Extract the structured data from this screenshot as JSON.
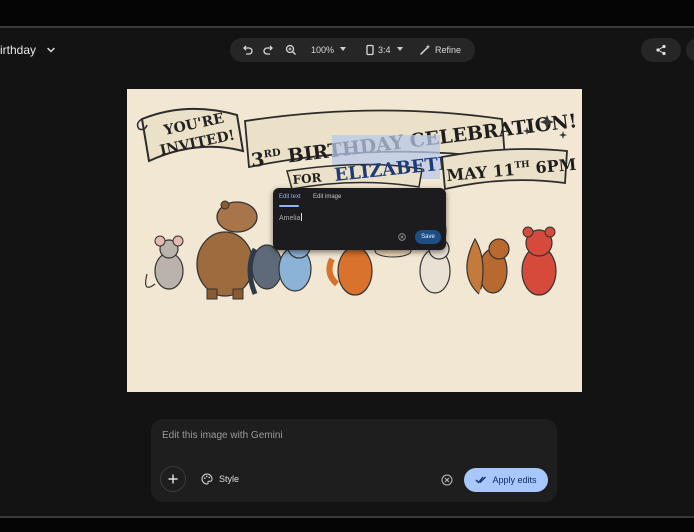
{
  "header": {
    "title": "irthday",
    "undo_icon": "undo-icon",
    "redo_icon": "redo-icon",
    "zoom_icon": "zoom-in-icon",
    "zoom_value": "100%",
    "aspect_icon": "aspect-ratio-icon",
    "aspect_value": "3:4",
    "refine_label": "Refine",
    "share_icon": "share-icon"
  },
  "image": {
    "banner_left_line1": "YOU'RE",
    "banner_left_line2": "INVITED!",
    "headline_prefix": "3",
    "headline_sup": "RD",
    "headline_main": " BIRTHDAY CELEBRATION!",
    "for_label": "FOR",
    "name": "ELIZABETH",
    "date_prefix": "MAY 11",
    "date_sup": "TH",
    "time": " 6PM"
  },
  "edit_popup": {
    "tab_edit_text": "Edit text",
    "tab_edit_image": "Edit image",
    "input_value": "Amelia",
    "save_label": "Save"
  },
  "prompt": {
    "placeholder": "Edit this image with Gemini",
    "style_label": "Style",
    "apply_label": "Apply edits"
  },
  "colors": {
    "accent": "#a8c7fa",
    "save_button": "#1d4f86",
    "background": "#131313",
    "parchment": "#f1e7d2"
  }
}
